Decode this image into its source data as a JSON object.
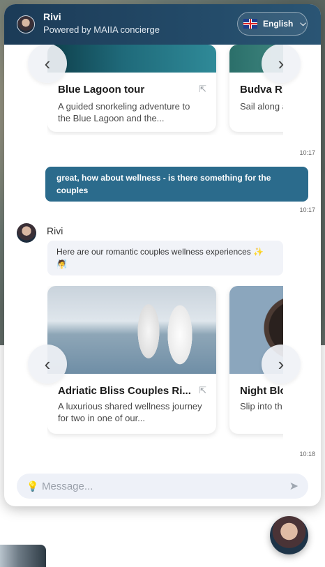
{
  "header": {
    "name": "Rivi",
    "subtitle": "Powered by MAIIA concierge",
    "language": "English",
    "language_flag": "uk-flag-icon"
  },
  "carousel_top": {
    "cards": [
      {
        "title": "Blue Lagoon tour",
        "description": "A guided snorkeling adventure to the Blue Lagoon and the..."
      },
      {
        "title": "Budva Ri",
        "description": "Sail along as the sun"
      }
    ],
    "time": "10:17"
  },
  "user_message": {
    "text": "great, how about wellness - is there something for the couples",
    "time": "10:17"
  },
  "bot_message": {
    "name": "Rivi",
    "text": "Here are our romantic couples wellness experiences ✨🧖"
  },
  "carousel_bottom": {
    "cards": [
      {
        "title": "Adriatic Bliss Couples Ri...",
        "description": "A luxurious shared wellness journey for two in one of our..."
      },
      {
        "title": "Night Blo",
        "description": "Slip into th a unique t"
      }
    ],
    "time": "10:18"
  },
  "composer": {
    "placeholder": "Message..."
  },
  "colors": {
    "header": "#1c3b57",
    "user_bubble": "#2b6b8c",
    "bot_bubble": "#f1f3f8"
  }
}
